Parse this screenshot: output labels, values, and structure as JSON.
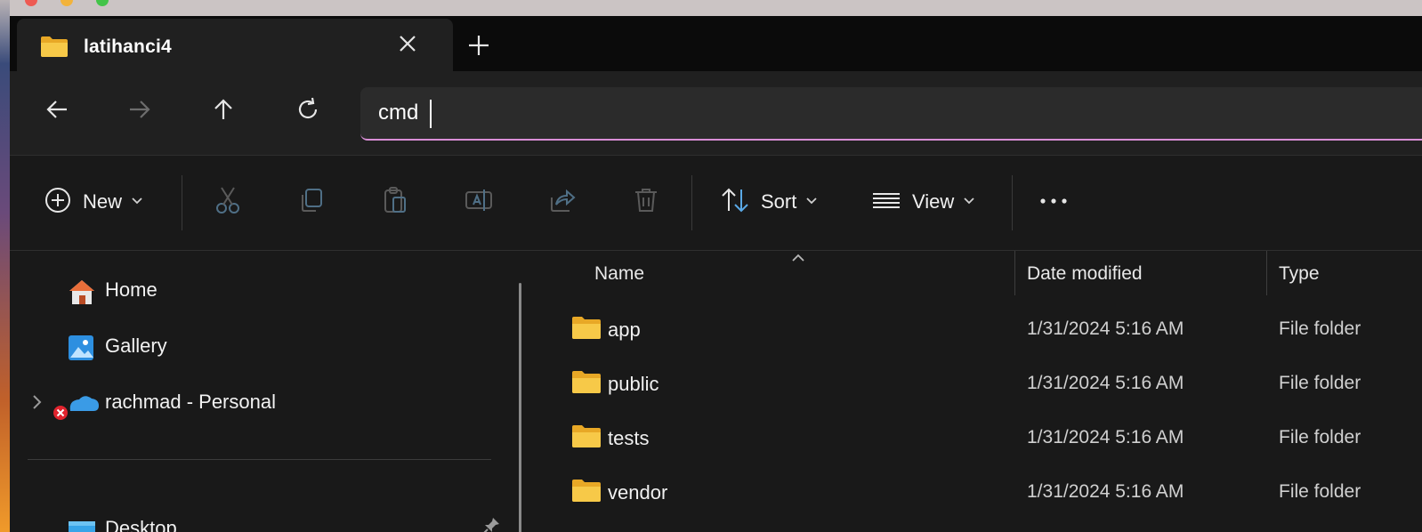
{
  "tab": {
    "title": "latihanci4",
    "new_tab": "+"
  },
  "address": {
    "value": "cmd"
  },
  "nav_buttons": [
    "back",
    "forward",
    "up",
    "refresh"
  ],
  "commands": {
    "new": "New",
    "sort": "Sort",
    "view": "View",
    "more": "..."
  },
  "command_icons": [
    "cut-icon",
    "copy-icon",
    "paste-icon",
    "rename-icon",
    "share-icon",
    "delete-icon"
  ],
  "nav_pane": {
    "items": [
      {
        "label": "Home",
        "icon": "home-icon"
      },
      {
        "label": "Gallery",
        "icon": "gallery-icon"
      },
      {
        "label": "rachmad - Personal",
        "icon": "onedrive-icon"
      },
      {
        "label": "Desktop",
        "icon": "desktop-icon"
      }
    ]
  },
  "columns": {
    "name": "Name",
    "date": "Date modified",
    "type": "Type"
  },
  "files": [
    {
      "name": "app",
      "date": "1/31/2024 5:16 AM",
      "type": "File folder"
    },
    {
      "name": "public",
      "date": "1/31/2024 5:16 AM",
      "type": "File folder"
    },
    {
      "name": "tests",
      "date": "1/31/2024 5:16 AM",
      "type": "File folder"
    },
    {
      "name": "vendor",
      "date": "1/31/2024 5:16 AM",
      "type": "File folder"
    }
  ],
  "colors": {
    "accent": "#d98ed6",
    "folder": "#f5c242",
    "onedrive": "#3a9be6",
    "error": "#e0242e"
  }
}
